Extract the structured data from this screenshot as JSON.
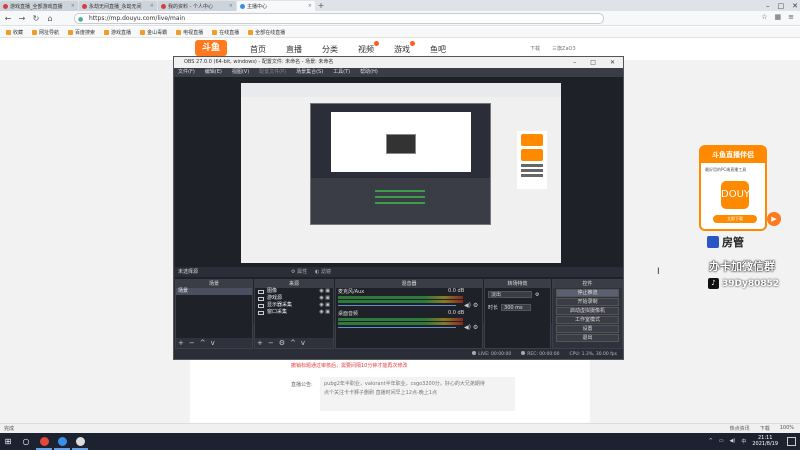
{
  "browser": {
    "tabs": [
      {
        "label": "游戏直播_全部游戏直播"
      },
      {
        "label": "永劫无间直播_永劫无间"
      },
      {
        "label": "我的资料 - 个人中心"
      },
      {
        "label": "主播中心"
      }
    ],
    "url": "https://mp.douyu.com/live/main",
    "bookmarks": [
      "收藏",
      "网址导航",
      "百度搜索",
      "游戏直播",
      "金山毒霸",
      "电视直播",
      "在线直播",
      "全部在线直播"
    ],
    "status_left": "完成",
    "status_right": [
      "热点资讯",
      "下载",
      "100%"
    ]
  },
  "site": {
    "logo": "斗鱼",
    "nav": [
      "首页",
      "直播",
      "分类",
      "视频",
      "游戏",
      "鱼吧"
    ],
    "header_right": [
      "下载",
      "三旗ZaO3"
    ],
    "notice_red": "撤销标题通过审核后，需要间隔10分钟才能再次修改",
    "notice_label": "直播公告:",
    "notice_text": [
      "pubg2年半职业，valorant半年职业，csgo3200分。好心的大兄弟期待",
      "点个关注卡卡狮子删刷 直播时间早上12点-晚上1点"
    ]
  },
  "obs": {
    "title": "OBS 27.0.0 (64-bit, windows) - 配置文件: 未命名 - 场景: 未命名",
    "menu": [
      "文件(F)",
      "编辑(E)",
      "视图(V)",
      "配置文件(P)",
      "场景集合(S)",
      "工具(T)",
      "帮助(H)"
    ],
    "dock_title": "未选择源",
    "dock_props": "属性",
    "dock_filters": "滤镜",
    "docks": {
      "scenes": {
        "title": "场景",
        "items": [
          "场景"
        ]
      },
      "sources": {
        "title": "来源",
        "items": [
          "图像",
          "游戏源",
          "显示器采集",
          "窗口采集"
        ]
      },
      "mixer": {
        "title": "混音器",
        "channels": [
          {
            "name": "麦克风/Aux",
            "level": "0.0 dB"
          },
          {
            "name": "桌面音频",
            "level": "0.0 dB"
          }
        ]
      },
      "transitions": {
        "title": "转场特效",
        "type": "淡出",
        "duration_label": "时长",
        "duration": "300 ms"
      },
      "controls": {
        "title": "控件",
        "buttons": [
          "停止推流",
          "开始录制",
          "启动虚拟摄像机",
          "工作室模式",
          "设置",
          "退出"
        ]
      }
    },
    "status": [
      "LIVE: 00:00:00",
      "REC: 00:00:00",
      "CPU: 1.3%, 30.00 fps"
    ]
  },
  "overlay": {
    "ad_title": "斗鱼直播伴侣",
    "ad_sub": "最好用的PC端直播工具",
    "ad_icon": "DOUYU",
    "ad_button": "立即下载",
    "line1": "房管",
    "line2": "办卡加微信群",
    "line3": "39Dy80852"
  },
  "taskbar": {
    "time": "21:11",
    "date": "2021/8/19",
    "lang": "中"
  }
}
